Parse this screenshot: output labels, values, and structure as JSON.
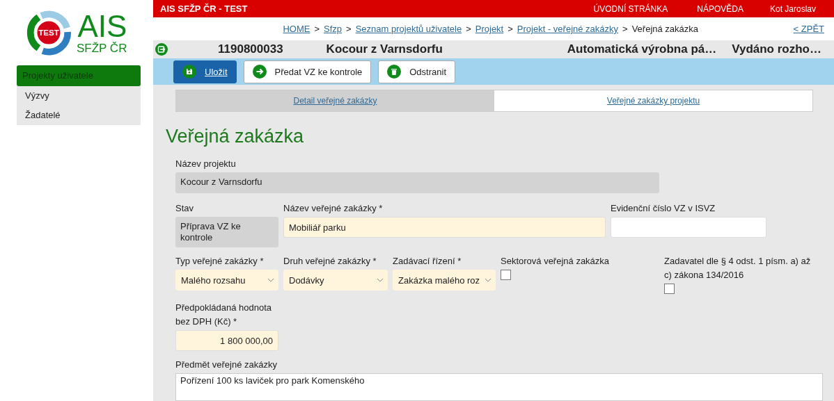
{
  "logo": {
    "badge": "TEST",
    "name": "AIS",
    "subtitle": "SFŽP ČR"
  },
  "sidebar": {
    "items": [
      {
        "label": "Projekty uživatele",
        "selected": true
      },
      {
        "label": "Výzvy",
        "selected": false
      },
      {
        "label": "Žadatelé",
        "selected": false
      }
    ]
  },
  "header": {
    "app_title": "AIS SFŽP ČR - TEST",
    "nav": [
      "ÚVODNÍ STRÁNKA",
      "NÁPOVĚDA"
    ],
    "user": "Kot Jaroslav"
  },
  "breadcrumb": {
    "items": [
      {
        "label": "HOME",
        "link": true
      },
      {
        "label": "Sfzp",
        "link": true
      },
      {
        "label": "Seznam projektů uživatele",
        "link": true
      },
      {
        "label": "Projekt",
        "link": true
      },
      {
        "label": "Projekt - veřejné zakázky",
        "link": true
      },
      {
        "label": "Veřejná zakázka",
        "link": false
      }
    ],
    "separator": ">",
    "back": "< ZPĚT"
  },
  "project_bar": {
    "number": "1190800033",
    "name": "Kocour z Varnsdorfu",
    "subject": "Automatická výrobna pá…",
    "status": "Vydáno rozho…"
  },
  "toolbar": [
    {
      "label": "Uložit",
      "kind": "save"
    },
    {
      "label": "Předat VZ ke kontrole",
      "kind": "submit"
    },
    {
      "label": "Odstranit",
      "kind": "delete"
    }
  ],
  "tabs": [
    {
      "label": "Detail veřejné zakázky",
      "selected": true
    },
    {
      "label": "Veřejné zakázky projektu",
      "selected": false
    }
  ],
  "heading": "Veřejná zakázka",
  "form": {
    "rows": [
      [
        {
          "kind": "readonly",
          "label": "Název projektu",
          "value": "Kocour z Varnsdorfu"
        }
      ],
      [
        {
          "kind": "readonly",
          "label": "Stav",
          "value": "Příprava VZ ke kontrole"
        },
        {
          "kind": "text",
          "label": "Název veřejné zakázky *",
          "value": "Mobiliář parku",
          "required": true
        },
        {
          "kind": "text",
          "label": "Evidenční číslo VZ v ISVZ",
          "required": false
        }
      ],
      [
        {
          "kind": "select",
          "label": "Typ veřejné zakázky *",
          "value": "Malého rozsahu"
        },
        {
          "kind": "select",
          "label": "Druh veřejné zakázky *",
          "value": "Dodávky"
        },
        {
          "kind": "select",
          "label": "Zadávací řízení *",
          "value": "Zakázka malého roz"
        },
        {
          "kind": "checkbox",
          "label": "Sektorová veřejná zakázka",
          "checked": false
        },
        {
          "kind": "checkbox",
          "label": "Zadavatel dle § 4 odst. 1 písm. a) až c) zákona 134/2016",
          "checked": false
        }
      ],
      [
        {
          "kind": "number",
          "label": "Předpokládaná hodnota bez DPH (Kč) *",
          "value": "1 800 000,00",
          "required": true
        }
      ],
      [
        {
          "kind": "textarea",
          "label": "Předmět veřejné zakázky",
          "value": "Pořízení 100 ks laviček pro park Komenského",
          "required": false
        }
      ]
    ]
  }
}
